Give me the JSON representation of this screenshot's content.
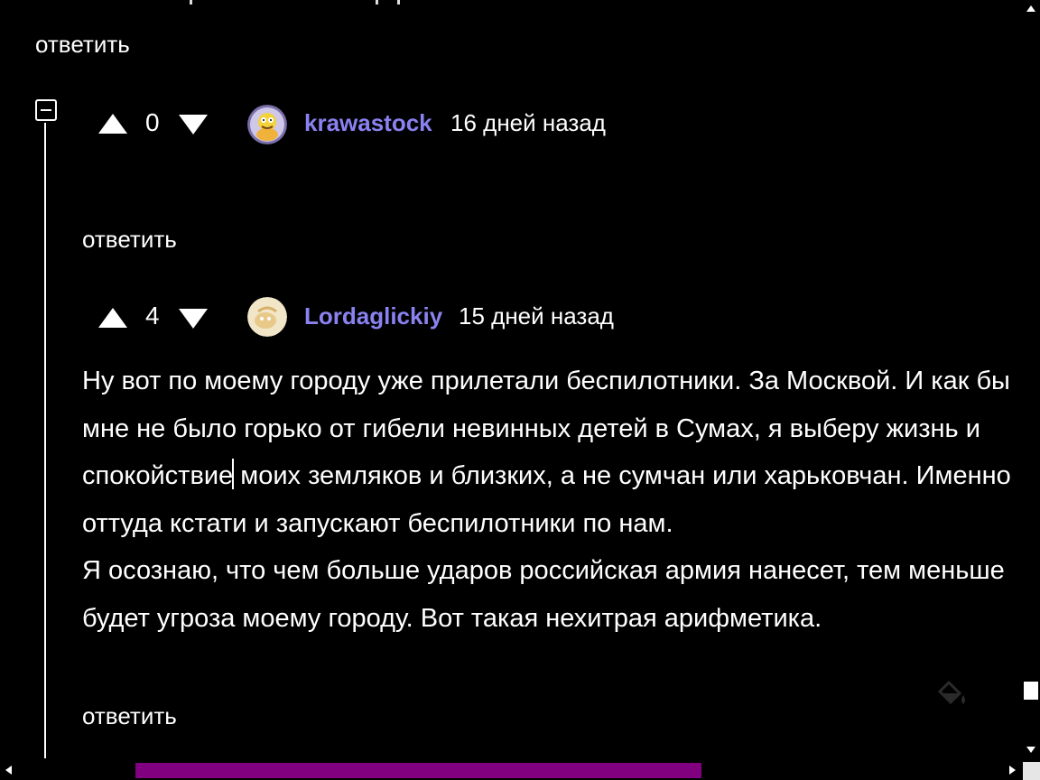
{
  "reply_label": "ответить",
  "comments": [
    {
      "score": "0",
      "username": "krawastock",
      "timestamp": "16 дней назад",
      "text": ""
    },
    {
      "score": "4",
      "username": "Lordaglickiy",
      "timestamp": "15 дней назад",
      "paragraphs": [
        "Ну вот по моему городу уже прилетали беспилотники. За Москвой. И как бы мне не было горько от гибели невинных детей в Сумах, я выберу жизнь и спокойствие",
        " моих земляков и близких, а не сумчан или харьковчан. Именно оттуда кстати и запускают беспилотники по нам.",
        "Я осознаю, что чем больше ударов российская армия нанесет, тем меньше будет угроза моему городу. Вот такая нехитрая арифметика."
      ]
    }
  ],
  "colors": {
    "background": "#000000",
    "text": "#ffffff",
    "username": "#8a82f0",
    "scrollbar_thumb": "#800080"
  },
  "icons": {
    "collapse": "minus-square-icon",
    "upvote": "triangle-up-icon",
    "downvote": "triangle-down-icon",
    "paint": "paint-bucket-icon"
  }
}
